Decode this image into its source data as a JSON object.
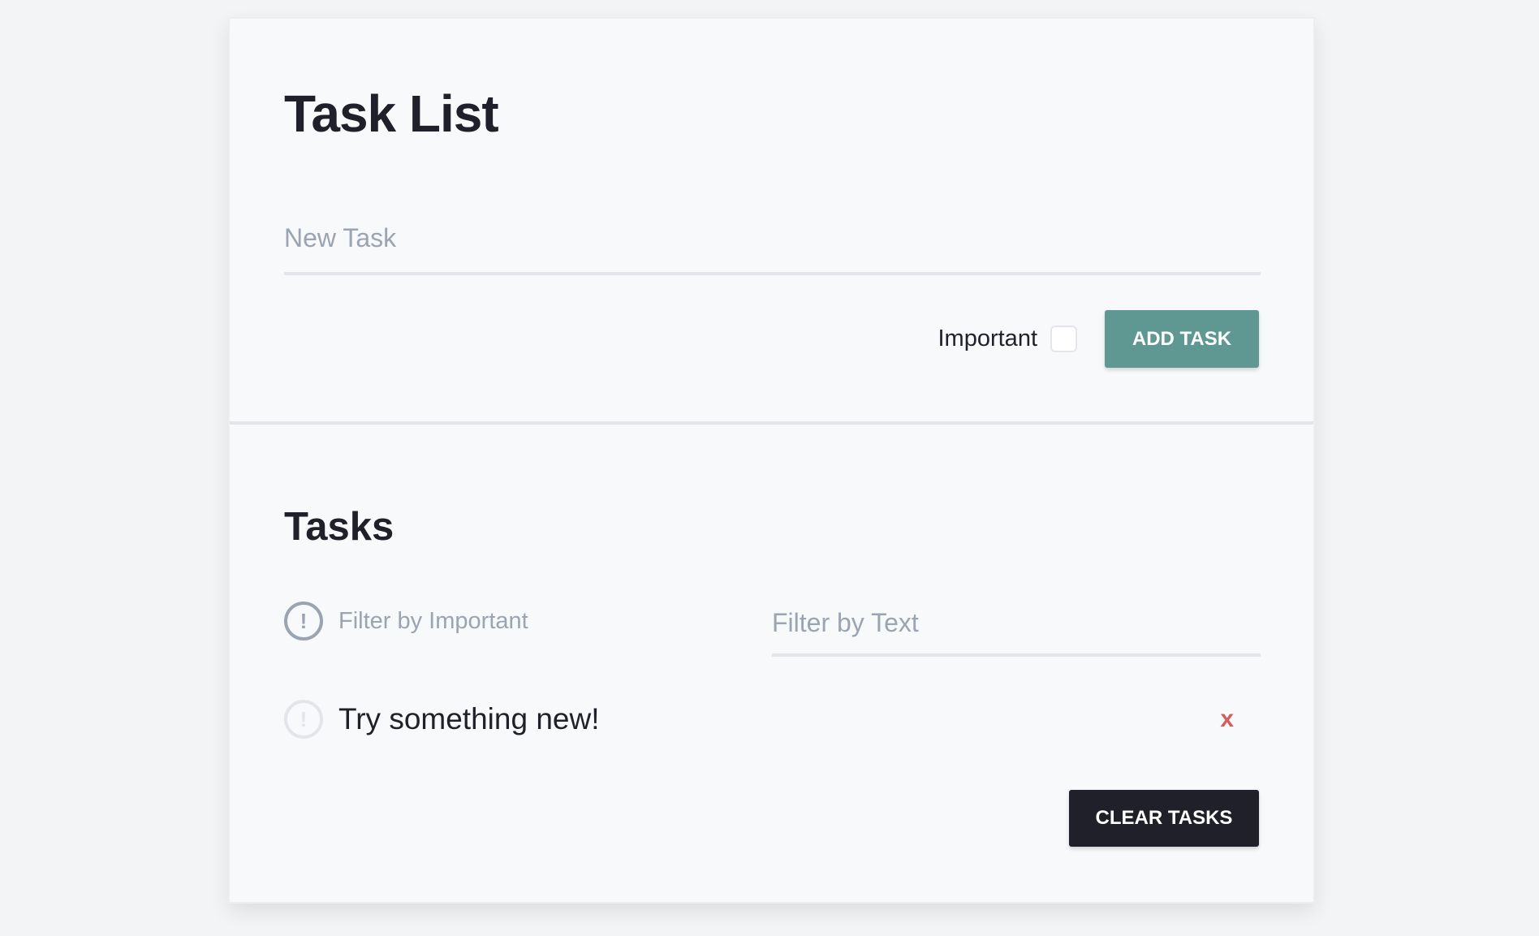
{
  "header": {
    "title": "Task List"
  },
  "new_task": {
    "placeholder": "New Task",
    "value": ""
  },
  "important": {
    "label": "Important",
    "checked": false
  },
  "add_button": {
    "label": "ADD TASK"
  },
  "tasks_section": {
    "heading": "Tasks",
    "filter_important_icon": "exclamation-circle-icon",
    "filter_important_label": "Filter by Important",
    "filter_text_placeholder": "Filter by Text",
    "items": [
      {
        "text": "Try something new!",
        "important": false,
        "important_icon": "exclamation-circle-icon",
        "delete_label": "x"
      }
    ],
    "clear_button_label": "CLEAR TASKS"
  },
  "colors": {
    "accent": "#5f9893",
    "dark": "#1f2029",
    "delete": "#d0605e",
    "muted": "#9aa4b2",
    "background": "#f8f9fa"
  }
}
